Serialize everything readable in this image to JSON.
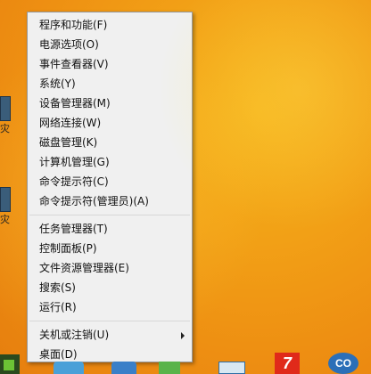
{
  "menu": {
    "groups": [
      {
        "items": [
          {
            "label": "程序和功能(F)"
          },
          {
            "label": "电源选项(O)"
          },
          {
            "label": "事件查看器(V)"
          },
          {
            "label": "系统(Y)"
          },
          {
            "label": "设备管理器(M)"
          },
          {
            "label": "网络连接(W)"
          },
          {
            "label": "磁盘管理(K)"
          },
          {
            "label": "计算机管理(G)"
          },
          {
            "label": "命令提示符(C)"
          },
          {
            "label": "命令提示符(管理员)(A)"
          }
        ]
      },
      {
        "items": [
          {
            "label": "任务管理器(T)"
          },
          {
            "label": "控制面板(P)"
          },
          {
            "label": "文件资源管理器(E)"
          },
          {
            "label": "搜索(S)"
          },
          {
            "label": "运行(R)"
          }
        ]
      },
      {
        "items": [
          {
            "label": "关机或注销(U)",
            "has_submenu": true
          },
          {
            "label": "桌面(D)"
          }
        ]
      }
    ]
  },
  "desktop": {
    "left_labels": [
      "灾",
      "灾"
    ]
  },
  "taskbar": {
    "seven_icon_text": "7",
    "co_icon_text": "CO"
  }
}
